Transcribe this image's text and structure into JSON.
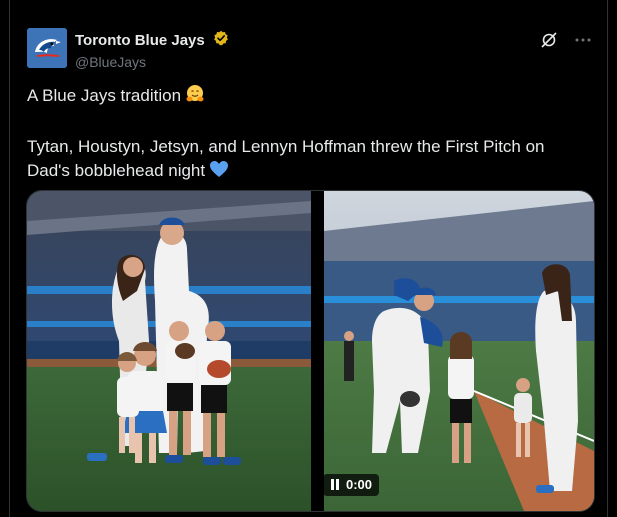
{
  "account": {
    "display_name": "Toronto Blue Jays",
    "handle": "@BlueJays",
    "avatar_icon": "blue-jay-logo",
    "verified_icon": "gold-verified-badge"
  },
  "header_actions": {
    "grok_icon": "grok-icon",
    "more_icon": "more-icon"
  },
  "tweet": {
    "line1": "A Blue Jays tradition",
    "line1_emoji": "hugging-face-emoji",
    "line2": "Tytan, Houstyn, Jetsyn, and Lennyn Hoffman threw the First Pitch on Dad's bobblehead night",
    "line2_emoji": "blue-heart-emoji"
  },
  "media": {
    "left_icon": "family-photo",
    "right_icon": "first-pitch-video",
    "video_time": "0:00",
    "video_control_icon": "pause-icon"
  },
  "colors": {
    "background": "#000000",
    "text": "#e7e9ea",
    "secondary_text": "#71767b",
    "verified_gold": "#e2b719",
    "heart_blue": "#5aa0f0"
  }
}
